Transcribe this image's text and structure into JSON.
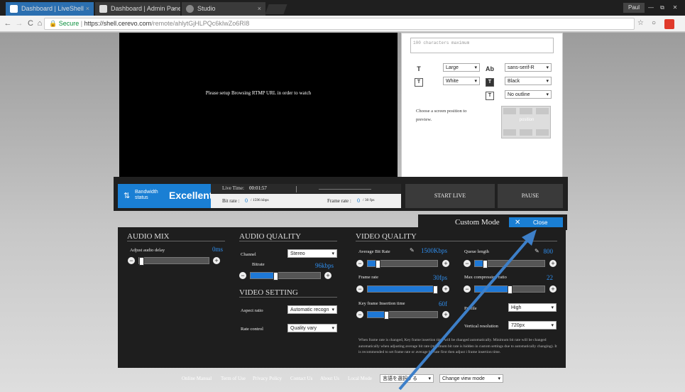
{
  "browser": {
    "tabs": [
      {
        "label": "Dashboard | LiveShell",
        "close": "×"
      },
      {
        "label": "Dashboard | Admin Pane",
        "close": "×"
      },
      {
        "label": "Studio",
        "close": "×"
      }
    ],
    "user": "Paul",
    "window_controls": [
      "—",
      "⧉",
      "✕"
    ],
    "nav": {
      "back": "←",
      "forward": "→",
      "reload": "C",
      "home": "⌂"
    },
    "secure_label": "Secure",
    "url_host": "https://shell.cerevo.com",
    "url_path": "/remote/ahlytGjHLPQc6kIwZo6RI8"
  },
  "video": {
    "message": "Please setup Browsing RTMP URL in order to watch"
  },
  "overlay": {
    "textarea_placeholder": "100 characters maximum",
    "font_size": "Large",
    "font_family": "sans-serif-R",
    "text_color": "White",
    "bg_color": "Black",
    "outline": "No outline",
    "position_hint": "Choose a screen position to preview.",
    "position_label": "position",
    "icons": {
      "size": "fontsize-icon",
      "font": "Ab",
      "color": "text-color-icon",
      "bg": "bg-color-icon",
      "outline": "outline-icon"
    }
  },
  "status": {
    "bandwidth_label": "Bandwidth status",
    "bandwidth_value": "Excellent",
    "live_time_label": "Live Time:",
    "live_time": "00:01:57",
    "bitrate_label": "Bit rate :",
    "bitrate_value": "0",
    "bitrate_max": "/ 1596 kbps",
    "framerate_label": "Frame rate :",
    "framerate_value": "0",
    "framerate_max": "/ 30 fps",
    "start_button": "START LIVE",
    "pause_button": "PAUSE"
  },
  "settings": {
    "mode_label": "Custom Mode",
    "close_label": "Close",
    "audio_mix": {
      "title": "AUDIO MIX",
      "delay_label": "Adjust audio delay",
      "delay_value": "0ms",
      "delay_level": 0.0
    },
    "audio_quality": {
      "title": "AUDIO QUALITY",
      "channel_label": "Channel",
      "channel_value": "Stereo",
      "bitrate_label": "Bitrate",
      "bitrate_value": "96kbps",
      "bitrate_level": 0.35
    },
    "video_setting": {
      "title": "VIDEO SETTING",
      "aspect_label": "Aspect ratio",
      "aspect_value": "Automatic recogn",
      "rate_label": "Rate control",
      "rate_value": "Quality vary"
    },
    "video_quality": {
      "title": "VIDEO QUALITY",
      "avg_bitrate_label": "Average Bit Rate",
      "avg_bitrate_value": "1500Kbps",
      "avg_bitrate_level": 0.12,
      "frame_rate_label": "Frame rate",
      "frame_rate_value": "30fps",
      "frame_rate_level": 1.0,
      "keyframe_label": "Key frame Insertion time",
      "keyframe_value": "60f",
      "keyframe_level": 0.25,
      "queue_label": "Queue length",
      "queue_value": "800",
      "queue_level": 0.12,
      "max_comp_label": "Max compression ratio",
      "max_comp_value": "22",
      "max_comp_level": 0.5,
      "profile_label": "Profile",
      "profile_value": "High",
      "vres_label": "Vertical resolution",
      "vres_value": "720px",
      "note": "When frame rate is changed, Key frame insertion time will be changed automatically. Minimum bit rate will be changed automatically when adjusting average bit rate (minimum bit rate is hidden in custom settings due to automatically changing). It is recommended to set frame rate or average bit rate first then adjust i frame insertion time."
    }
  },
  "footer": {
    "links": [
      "Online Manual",
      "Term of Use",
      "Privacy Policy",
      "Contact Us",
      "About Us",
      "Local Mode"
    ],
    "language": "言語を選択する",
    "view_mode": "Change view mode"
  },
  "colors": {
    "accent": "#1a7fd4",
    "panel": "#1e1e1e",
    "slider_fill": "#1e78d6"
  }
}
